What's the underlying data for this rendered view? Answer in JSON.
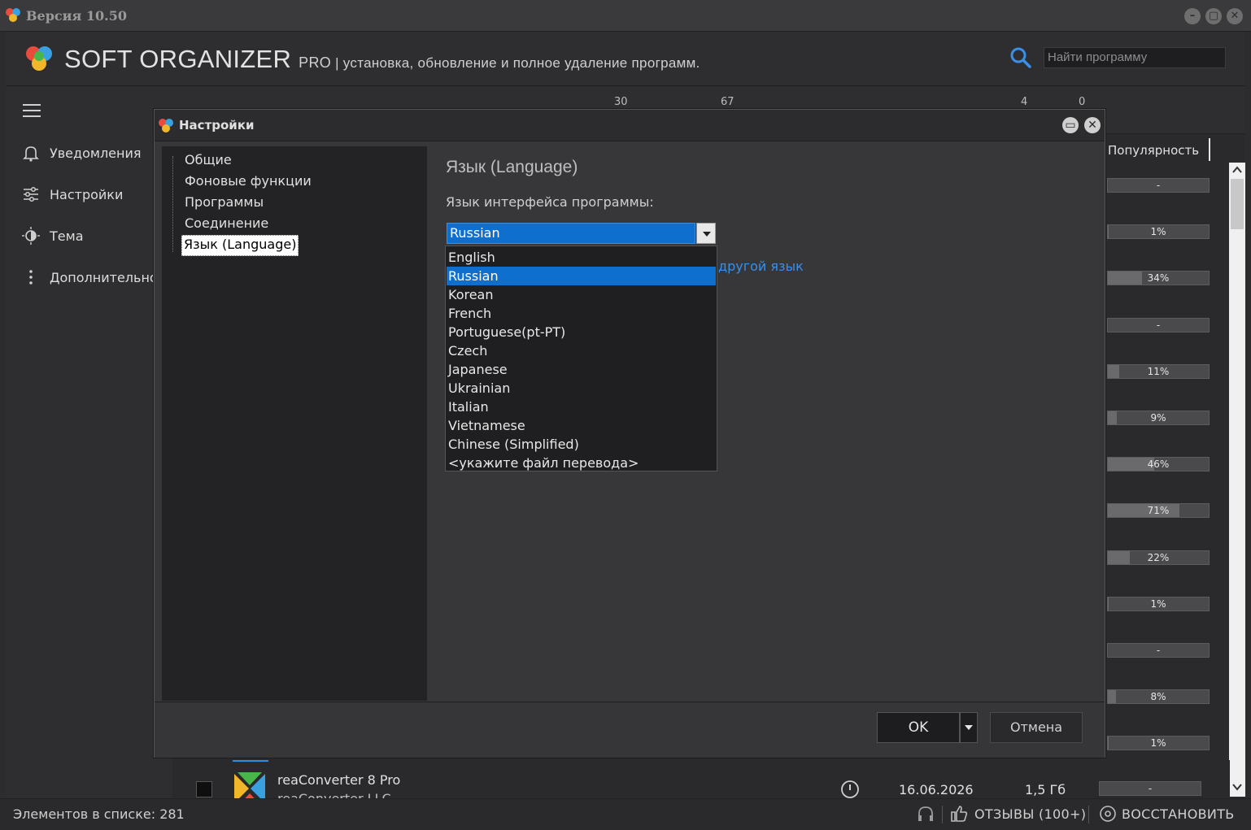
{
  "window": {
    "title": "Версия 10.50"
  },
  "header": {
    "brand": "SOFT ORGANIZER",
    "pro": "PRO",
    "tagline": " | установка, обновление и полное удаление программ.",
    "search_placeholder": "Найти программу"
  },
  "sidebar": {
    "items": [
      {
        "label": "Уведомления",
        "icon": "bell-icon"
      },
      {
        "label": "Настройки",
        "icon": "sliders-icon"
      },
      {
        "label": "Тема",
        "icon": "theme-icon"
      },
      {
        "label": "Дополнительно",
        "icon": "more-vertical-icon"
      }
    ]
  },
  "toolbar": {
    "count_a": "30",
    "count_b": "67",
    "count_c": "4",
    "count_d": "0"
  },
  "list": {
    "column_popularity": "Популярность",
    "popularity": [
      {
        "label": "-",
        "value": 0
      },
      {
        "label": "1%",
        "value": 0.01
      },
      {
        "label": "34%",
        "value": 0.34
      },
      {
        "label": "-",
        "value": 0
      },
      {
        "label": "11%",
        "value": 0.11
      },
      {
        "label": "9%",
        "value": 0.09
      },
      {
        "label": "46%",
        "value": 0.46
      },
      {
        "label": "71%",
        "value": 0.71
      },
      {
        "label": "22%",
        "value": 0.22
      },
      {
        "label": "1%",
        "value": 0.01
      },
      {
        "label": "-",
        "value": 0
      },
      {
        "label": "8%",
        "value": 0.08
      },
      {
        "label": "1%",
        "value": 0.01
      }
    ],
    "bottom_row": {
      "name": "reaConverter 8 Pro",
      "publisher": "reaConverter LLC",
      "date": "16.06.2026",
      "size": "1,5 Гб",
      "popularity": "-"
    }
  },
  "status": {
    "count": "Элементов в списке: 281",
    "reviews": "ОТЗЫВЫ (100+)",
    "restore": "ВОССТАНОВИТЬ"
  },
  "dialog": {
    "title": "Настройки",
    "tree": [
      "Общие",
      "Фоновые функции",
      "Программы",
      "Соединение",
      "Язык (Language)"
    ],
    "tree_selected": 4,
    "heading": "Язык (Language)",
    "language_label": "Язык интерфейса программы:",
    "language_value": "Russian",
    "other_language_link": "другой язык",
    "languages": [
      "English",
      "Russian",
      "Korean",
      "French",
      "Portuguese(pt-PT)",
      "Czech",
      "Japanese",
      "Ukrainian",
      "Italian",
      "Vietnamese",
      "Chinese (Simplified)",
      "<укажите файл перевода>"
    ],
    "languages_selected": 1,
    "ok": "OK",
    "cancel": "Отмена"
  }
}
